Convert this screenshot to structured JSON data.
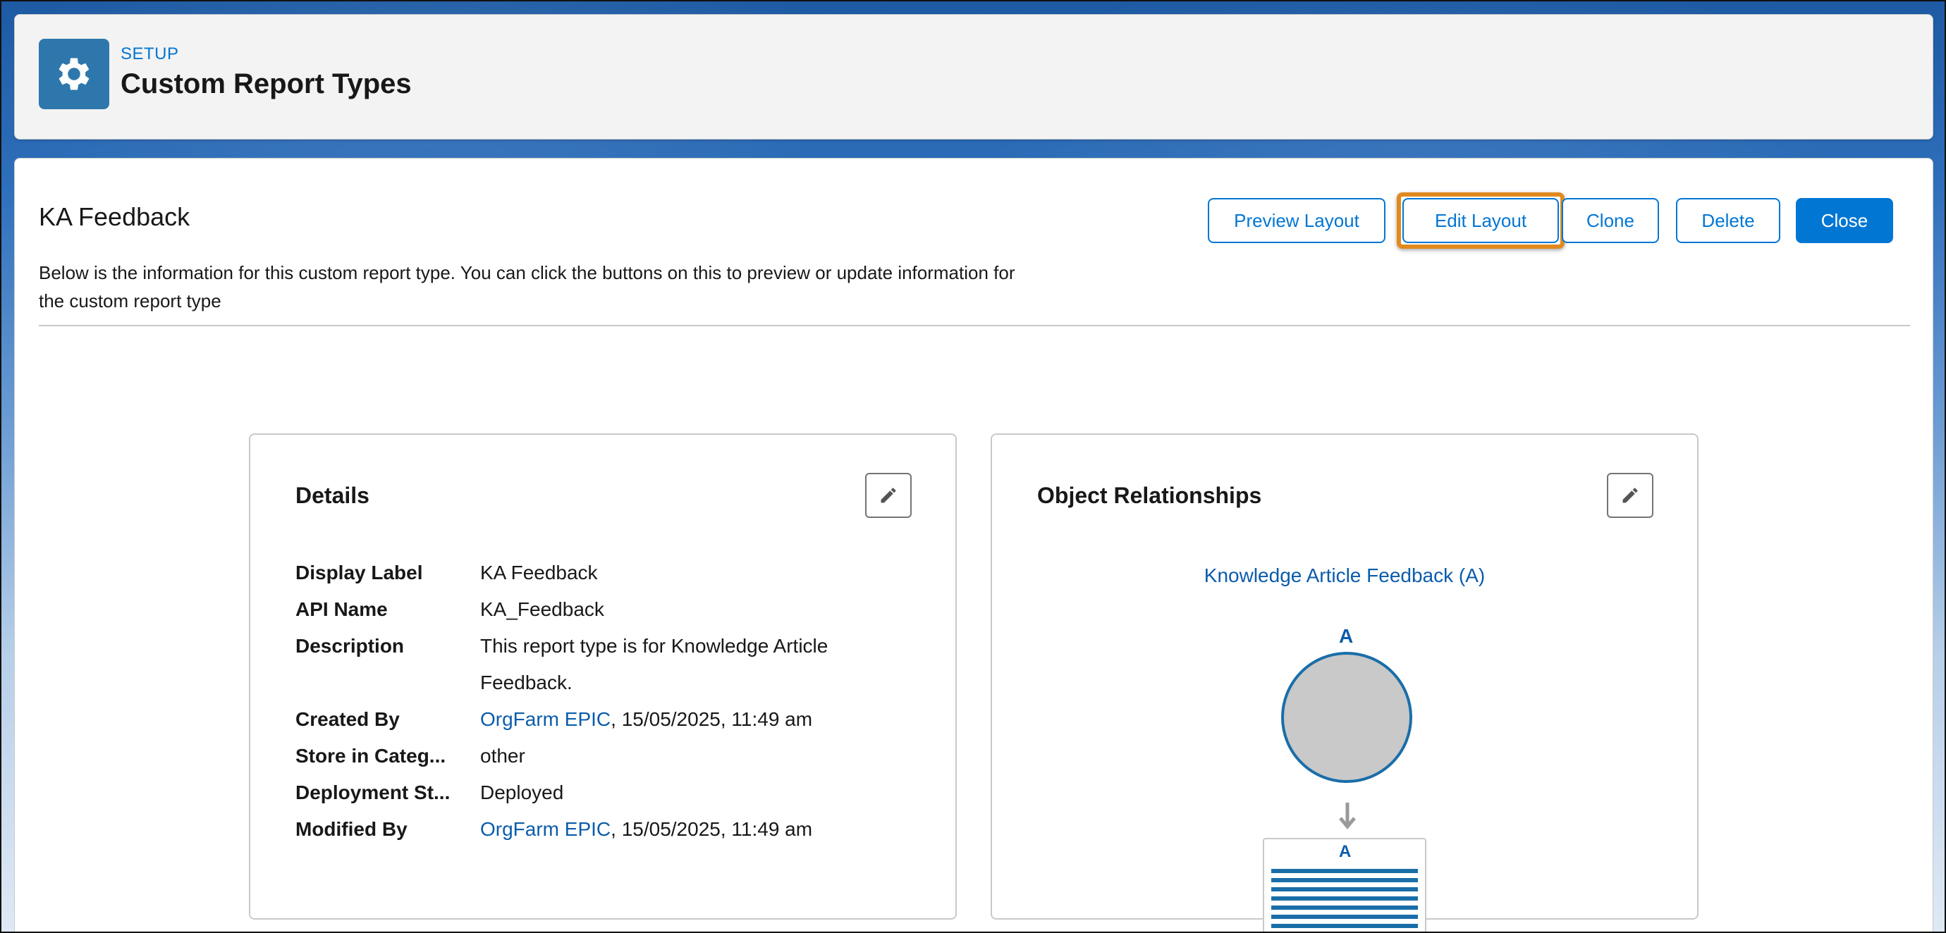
{
  "header": {
    "eyebrow": "SETUP",
    "title": "Custom Report Types",
    "icon": "gear-icon"
  },
  "record": {
    "title": "KA Feedback",
    "description": "Below is the information for this custom report type. You can click the buttons on this to preview or update information for the custom report type"
  },
  "actions": {
    "preview_layout": "Preview Layout",
    "edit_layout": "Edit Layout",
    "clone": "Clone",
    "delete": "Delete",
    "close": "Close"
  },
  "details": {
    "title": "Details",
    "fields": [
      {
        "label": "Display Label",
        "value": "KA Feedback"
      },
      {
        "label": "API Name",
        "value": "KA_Feedback"
      },
      {
        "label": "Description",
        "value": "This report type is for Knowledge Article",
        "value2": "Feedback."
      },
      {
        "label": "Created By",
        "link": "OrgFarm EPIC",
        "value": ", 15/05/2025, 11:49 am"
      },
      {
        "label": "Store in Categ...",
        "value": "other"
      },
      {
        "label": "Deployment St...",
        "value": "Deployed"
      },
      {
        "label": "Modified By",
        "link": "OrgFarm EPIC",
        "value": ", 15/05/2025, 11:49 am"
      }
    ]
  },
  "relationships": {
    "title": "Object Relationships",
    "primary_object_link": "Knowledge Article Feedback (A)",
    "circle_label": "A",
    "table_label": "A"
  },
  "colors": {
    "brand": "#0176d3",
    "highlight": "#e08a1d",
    "link": "#0b5cab"
  }
}
